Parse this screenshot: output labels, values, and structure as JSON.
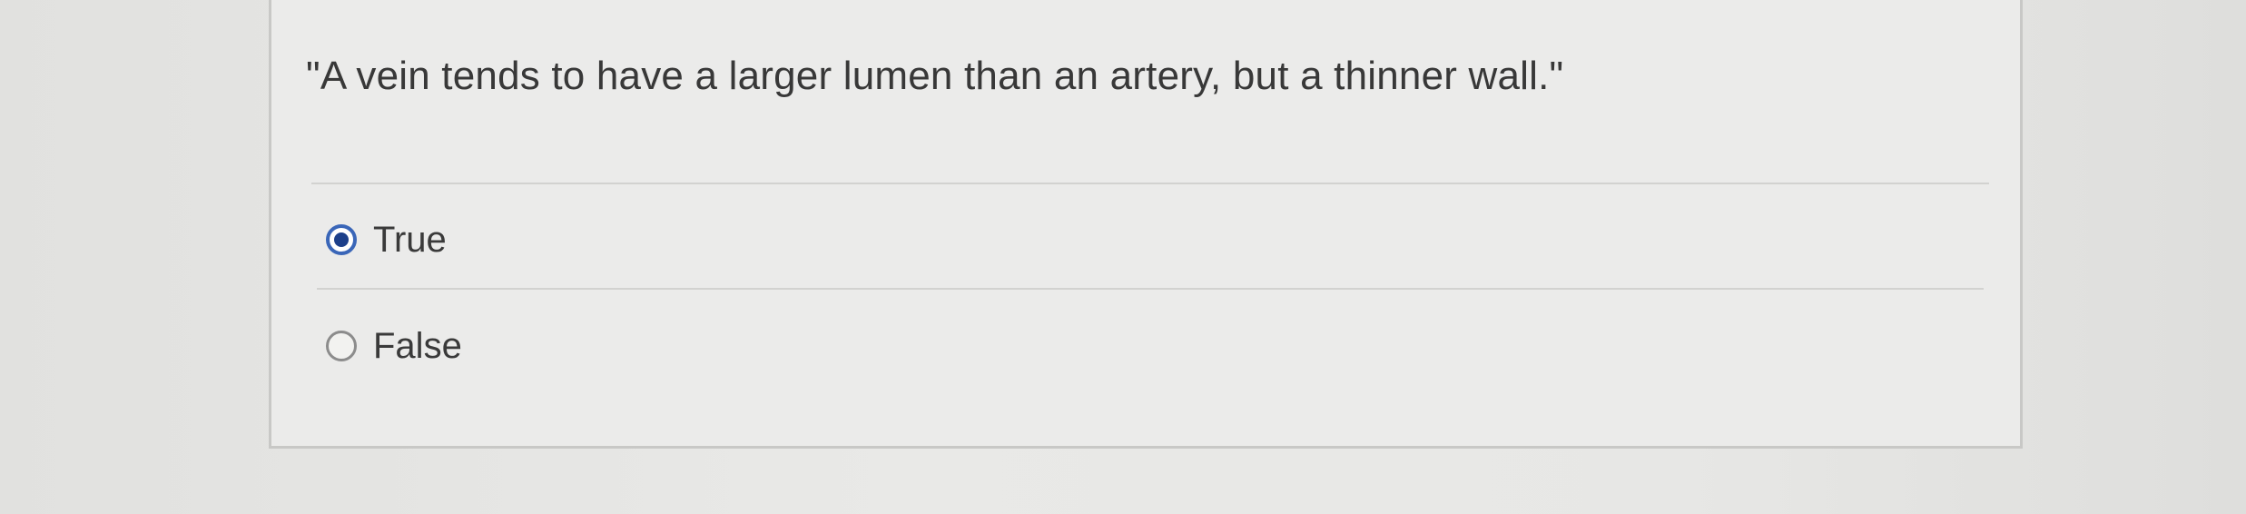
{
  "question": {
    "text": "\"A vein tends to have a larger lumen than an artery, but a thinner wall.\""
  },
  "options": [
    {
      "label": "True",
      "selected": true
    },
    {
      "label": "False",
      "selected": false
    }
  ],
  "colors": {
    "selected_radio": "#1c3f8a",
    "selected_ring": "#3a66b8"
  }
}
